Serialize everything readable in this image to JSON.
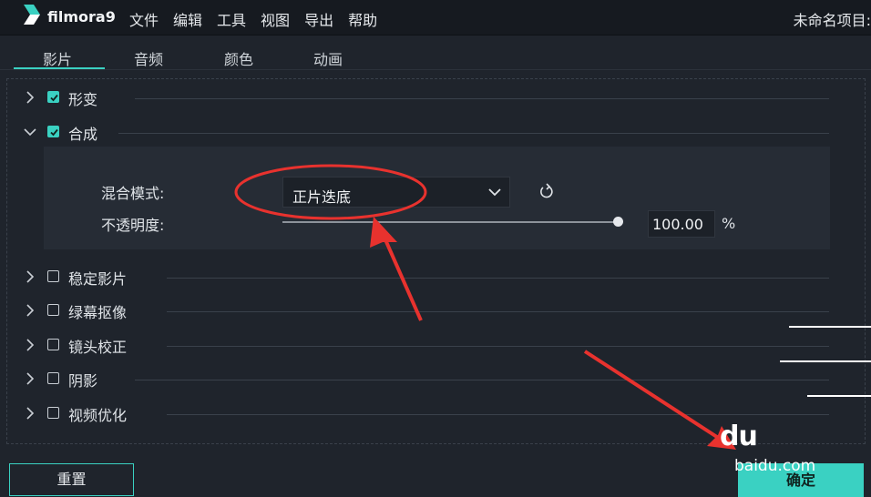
{
  "app": {
    "brand": "filmora9",
    "project_title": "未命名项目:"
  },
  "menu": [
    "文件",
    "编辑",
    "工具",
    "视图",
    "导出",
    "帮助"
  ],
  "tabs": [
    "影片",
    "音频",
    "颜色",
    "动画"
  ],
  "active_tab": 0,
  "sections": [
    {
      "label": "形变",
      "checked": true,
      "expanded": false
    },
    {
      "label": "合成",
      "checked": true,
      "expanded": true
    },
    {
      "label": "稳定影片",
      "checked": false,
      "expanded": false
    },
    {
      "label": "绿幕抠像",
      "checked": false,
      "expanded": false
    },
    {
      "label": "镜头校正",
      "checked": false,
      "expanded": false
    },
    {
      "label": "阴影",
      "checked": false,
      "expanded": false
    },
    {
      "label": "视频优化",
      "checked": false,
      "expanded": false
    }
  ],
  "composite": {
    "blend_mode_label": "混合模式:",
    "blend_mode_value": "正片迭底",
    "opacity_label": "不透明度:",
    "opacity_value": "100.00",
    "opacity_unit": "%",
    "opacity_fraction": 1.0
  },
  "buttons": {
    "reset": "重置",
    "ok": "确定"
  },
  "watermark": {
    "paw_text": "du",
    "site": "baidu.com"
  },
  "colors": {
    "accent": "#3ad1c2",
    "annotation": "#e8322e",
    "background": "#1f242c"
  }
}
